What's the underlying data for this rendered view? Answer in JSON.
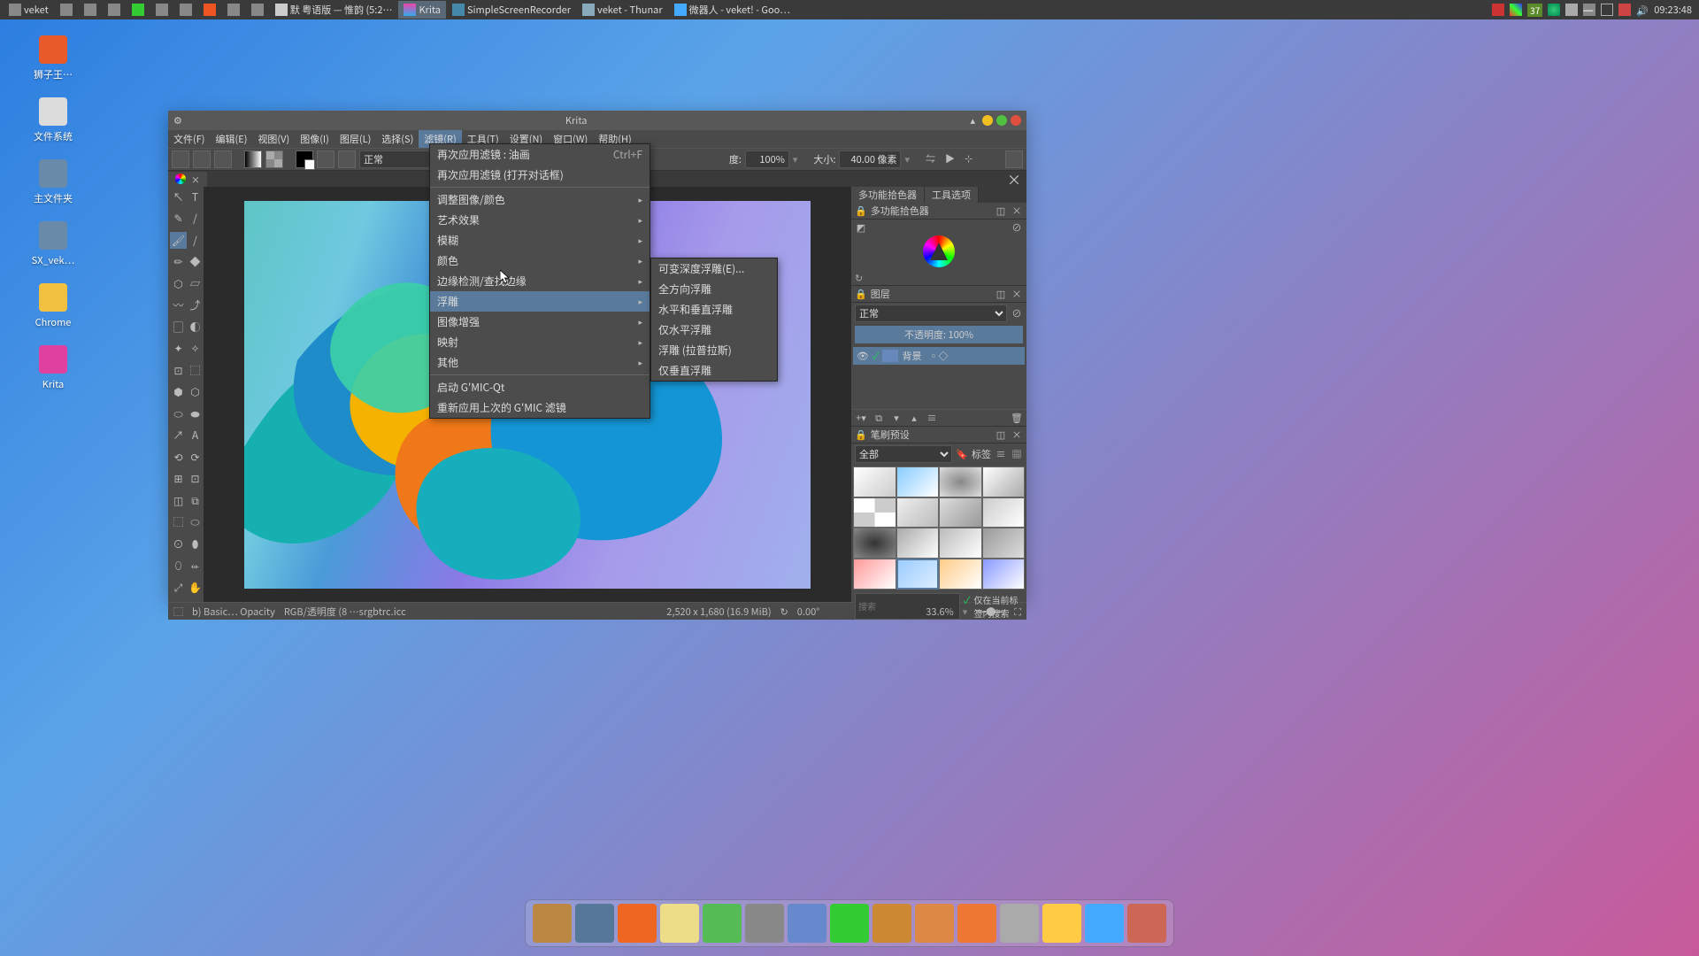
{
  "taskbar": {
    "left": [
      {
        "icon": "menu",
        "label": "veket"
      },
      {
        "icon": "img",
        "label": ""
      },
      {
        "icon": "drawer",
        "label": ""
      },
      {
        "icon": "wrench",
        "label": ""
      },
      {
        "icon": "play",
        "label": ""
      },
      {
        "icon": "term",
        "label": ""
      },
      {
        "icon": "screen",
        "label": ""
      },
      {
        "icon": "brave",
        "label": ""
      },
      {
        "icon": "clock",
        "label": ""
      },
      {
        "icon": "app",
        "label": ""
      },
      {
        "icon": "note",
        "label": "默 粤语版 — 惟韵 (5:2…",
        "active": false
      },
      {
        "icon": "krita",
        "label": "Krita",
        "active": true
      },
      {
        "icon": "rec",
        "label": "SimpleScreenRecorder"
      },
      {
        "icon": "fm",
        "label": "veket - Thunar"
      },
      {
        "icon": "web",
        "label": "微器人 - veket! - Goo…"
      }
    ],
    "temp": "37",
    "clock": "09:23:48"
  },
  "desktop": [
    {
      "label": "狮子王…",
      "color": "#e85a2a"
    },
    {
      "label": "文件系统",
      "color": "#dcdcdc"
    },
    {
      "label": "主文件夹",
      "color": "#6a8aaa"
    },
    {
      "label": "SX_vek…",
      "color": "#6a8aaa"
    },
    {
      "label": "Chrome",
      "color": "#f0c040"
    },
    {
      "label": "Krita",
      "color": "#e040a0"
    }
  ],
  "window": {
    "title": "Krita",
    "menus": [
      "文件(F)",
      "编辑(E)",
      "视图(V)",
      "图像(I)",
      "图层(L)",
      "选择(S)",
      "滤镜(R)",
      "工具(T)",
      "设置(N)",
      "窗口(W)",
      "帮助(H)"
    ],
    "active_menu": 6,
    "options": {
      "blend": "正常",
      "opacity_label": "度:",
      "opacity_value": "100%",
      "size_label": "大小:",
      "size_value": "40.00 像素"
    }
  },
  "dropdown1": [
    {
      "label": "再次应用滤镜 : 油画",
      "shortcut": "Ctrl+F"
    },
    {
      "label": "再次应用滤镜 (打开对话框)"
    },
    {
      "sep": true
    },
    {
      "label": "调整图像/颜色",
      "sub": true
    },
    {
      "label": "艺术效果",
      "sub": true
    },
    {
      "label": "模糊",
      "sub": true
    },
    {
      "label": "颜色",
      "sub": true
    },
    {
      "label": "边缘检测/查找边缘",
      "sub": true
    },
    {
      "label": "浮雕",
      "sub": true,
      "hl": true
    },
    {
      "label": "图像增强",
      "sub": true
    },
    {
      "label": "映射",
      "sub": true
    },
    {
      "label": "其他",
      "sub": true
    },
    {
      "sep": true
    },
    {
      "label": "启动 G'MIC-Qt"
    },
    {
      "label": "重新应用上次的 G'MIC 滤镜"
    }
  ],
  "dropdown2": [
    {
      "label": "可变深度浮雕(E)..."
    },
    {
      "label": "全方向浮雕"
    },
    {
      "label": "水平和垂直浮雕"
    },
    {
      "label": "仅水平浮雕"
    },
    {
      "label": "浮雕 (拉普拉斯)"
    },
    {
      "label": "仅垂直浮雕"
    }
  ],
  "tools": [
    "↖",
    "T",
    "✎",
    "/",
    "🖌",
    "/",
    "✏",
    "◆",
    "⬡",
    "▱",
    "〰",
    "⤴",
    "▢",
    "◐",
    "✦",
    "✧",
    "⊡",
    "⬚",
    "⬢",
    "⬡",
    "⬭",
    "⬬",
    "↗",
    "A",
    "⟲",
    "⟳",
    "⊞",
    "⊡",
    "◫",
    "⧉",
    "⬚",
    "⬭",
    "⊙",
    "⬮",
    "⬯",
    "⬰",
    "⤢",
    "✋"
  ],
  "panels": {
    "tabs": [
      "多功能拾色器",
      "工具选项"
    ],
    "colorpicker_title": "多功能拾色器",
    "layers_title": "图层",
    "layer_mode": "正常",
    "layer_opacity_label": "不透明度:",
    "layer_opacity_value": "100%",
    "layer_name": "背景",
    "brushes_title": "笔刷预设",
    "brush_filter": "全部",
    "brush_tag": "标签",
    "search_placeholder": "搜索",
    "search_label": "仅在当前标签内搜索"
  },
  "status": {
    "profile": "b) Basic… Opacity",
    "colorspace": "RGB/透明度 (8 …srgbtrc.icc",
    "dimensions": "2,520 x 1,680 (16.9 MiB)",
    "angle": "0.00°",
    "zoom": "33.6%"
  },
  "dock_count": 15
}
